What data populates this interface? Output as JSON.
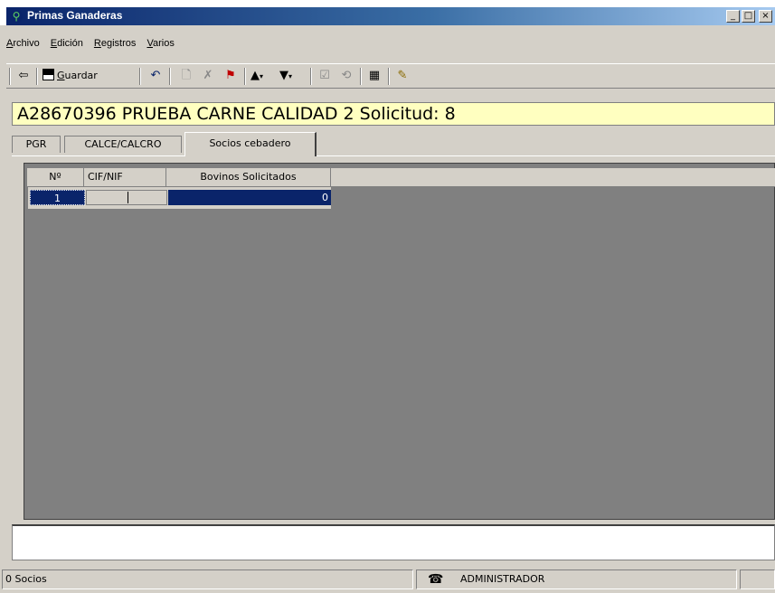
{
  "window": {
    "title": "Primas Ganaderas",
    "min": "_",
    "max": "□",
    "close": "×"
  },
  "menu": [
    {
      "accel": "A",
      "rest": "rchivo"
    },
    {
      "accel": "E",
      "rest": "dición"
    },
    {
      "accel": "R",
      "rest": "egistros"
    },
    {
      "accel": "V",
      "rest": "arios"
    }
  ],
  "toolbar": {
    "save_accel": "G",
    "save_rest": "uardar"
  },
  "record": {
    "header": "A28670396  PRUEBA CARNE CALIDAD 2  Solicitud: 8"
  },
  "tabs": [
    "PGR",
    "CALCE/CALCRO",
    "Socios cebadero"
  ],
  "grid": {
    "columns": [
      "Nº",
      "CIF/NIF",
      "Bovinos Solicitados"
    ],
    "rows": [
      {
        "num": "1",
        "cif": "",
        "bovinos": "0"
      }
    ]
  },
  "status": {
    "count": "0 Socios",
    "user": "ADMINISTRADOR"
  },
  "colors": {
    "title_start": "#0a246a",
    "title_end": "#a6caf0",
    "record_bg": "#ffffc0",
    "selection": "#0a246a",
    "grid_bg": "#808080"
  }
}
